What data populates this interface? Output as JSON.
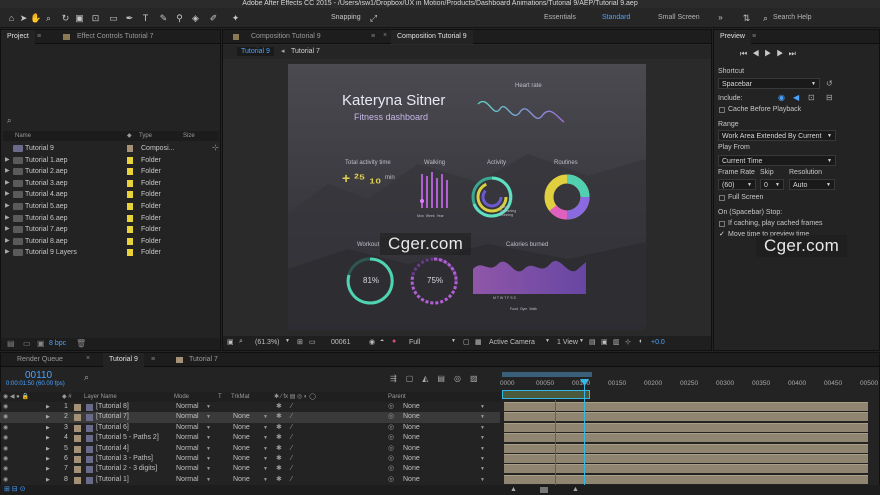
{
  "window": {
    "title": "Adobe After Effects CC 2015 - /Users/isw1/Dropbox/UX in Motion/Products/Dashboard Animations/Tutorial 9/AEP/Tutorial 9.aep"
  },
  "toolbar": {
    "snapping": "Snapping",
    "workspaces": [
      "Essentials",
      "Standard",
      "Small Screen"
    ],
    "active_workspace": "Standard",
    "search_placeholder": "Search Help"
  },
  "project": {
    "tabs": [
      "Project",
      "Effect Controls Tutorial 7"
    ],
    "columns": {
      "name": "Name",
      "type": "Type",
      "size": "Size"
    },
    "items": [
      {
        "name": "Tutorial 9",
        "type": "Composi...",
        "comp": true
      },
      {
        "name": "Tutorial 1.aep",
        "type": "Folder"
      },
      {
        "name": "Tutorial 2.aep",
        "type": "Folder"
      },
      {
        "name": "Tutorial 3.aep",
        "type": "Folder"
      },
      {
        "name": "Tutorial 4.aep",
        "type": "Folder"
      },
      {
        "name": "Tutorial 5.aep",
        "type": "Folder"
      },
      {
        "name": "Tutorial 6.aep",
        "type": "Folder"
      },
      {
        "name": "Tutorial 7.aep",
        "type": "Folder"
      },
      {
        "name": "Tutorial 8.aep",
        "type": "Folder"
      },
      {
        "name": "Tutorial 9 Layers",
        "type": "Folder"
      }
    ],
    "bpc": "8 bpc"
  },
  "composition": {
    "tabs": [
      "Composition Tutorial 9",
      "Composition Tutorial 9"
    ],
    "subtabs": [
      "Tutorial 9",
      "Tutorial 7"
    ],
    "footer": {
      "zoom": "(61.3%)",
      "timecode": "00061",
      "resolution": "Full",
      "camera": "Active Camera",
      "view": "1 View",
      "exposure": "+0.0"
    }
  },
  "dashboard": {
    "name": "Kateryna Sitner",
    "subtitle": "Fitness dashboard",
    "heart_rate": "Heart rate",
    "total_activity": "Total activity time",
    "total_value": "+ ²⁵ ₁₀",
    "min": "min",
    "walking": "Walking",
    "activity": "Activity",
    "routines": "Routines",
    "workout": "Workout",
    "calories": "Calories burned",
    "pct1": "81%",
    "pct2": "75%",
    "walk_labels": [
      "Mon",
      "Week",
      "Year"
    ],
    "activity_labels": [
      "Steps",
      "Swimming",
      "Running"
    ],
    "cal_axis": "M  T  W  T  F  S  S",
    "cal_legend": [
      "Food",
      "Gym",
      "Walk"
    ]
  },
  "preview": {
    "title": "Preview",
    "shortcut_label": "Shortcut",
    "shortcut_value": "Spacebar",
    "include_label": "Include:",
    "cache_before": "Cache Before Playback",
    "range_label": "Range",
    "range_value": "Work Area Extended By Current",
    "play_from_label": "Play From",
    "play_from_value": "Current Time",
    "frame_rate_label": "Frame Rate",
    "skip_label": "Skip",
    "resolution_label": "Resolution",
    "frame_rate_value": "(60)",
    "skip_value": "0",
    "resolution_value": "Auto",
    "full_screen": "Full Screen",
    "stop_label": "On (Spacebar) Stop:",
    "if_caching": "If caching, play cached frames",
    "move_time": "Move time to preview time"
  },
  "timeline": {
    "tabs": [
      "Render Queue",
      "Tutorial 9",
      "Tutorial 7"
    ],
    "timecode": "00110",
    "timecode_sub": "0:00:01:50 (60.00 fps)",
    "columns": {
      "layer": "Layer Name",
      "mode": "Mode",
      "t": "T",
      "trkmat": "TrkMat",
      "parent": "Parent"
    },
    "ruler": [
      "0000",
      "00050",
      "00100",
      "00150",
      "00200",
      "00250",
      "00300",
      "00350",
      "00400",
      "00450",
      "00500"
    ],
    "layers": [
      {
        "num": "1",
        "name": "[Tutorial 8]",
        "mode": "Normal",
        "trk": "",
        "parent": "None"
      },
      {
        "num": "2",
        "name": "[Tutorial 7]",
        "mode": "Normal",
        "trk": "None",
        "parent": "None"
      },
      {
        "num": "3",
        "name": "[Tutorial 6]",
        "mode": "Normal",
        "trk": "None",
        "parent": "None"
      },
      {
        "num": "4",
        "name": "[Tutorial 5 - Paths 2]",
        "mode": "Normal",
        "trk": "None",
        "parent": "None"
      },
      {
        "num": "5",
        "name": "[Tutorial 4]",
        "mode": "Normal",
        "trk": "None",
        "parent": "None"
      },
      {
        "num": "6",
        "name": "[Tutorial 3 - Paths]",
        "mode": "Normal",
        "trk": "None",
        "parent": "None"
      },
      {
        "num": "7",
        "name": "[Tutorial 2 - 3 digits]",
        "mode": "Normal",
        "trk": "None",
        "parent": "None"
      },
      {
        "num": "8",
        "name": "[Tutorial 1]",
        "mode": "Normal",
        "trk": "None",
        "parent": "None"
      }
    ]
  },
  "watermark": "Cger.com",
  "colors": {
    "accent": "#4aa3ff",
    "folder_label": "#e8d43a",
    "layer_bar": "#8f8570",
    "playhead": "#35b8e8",
    "work_marker": "#d03030"
  }
}
